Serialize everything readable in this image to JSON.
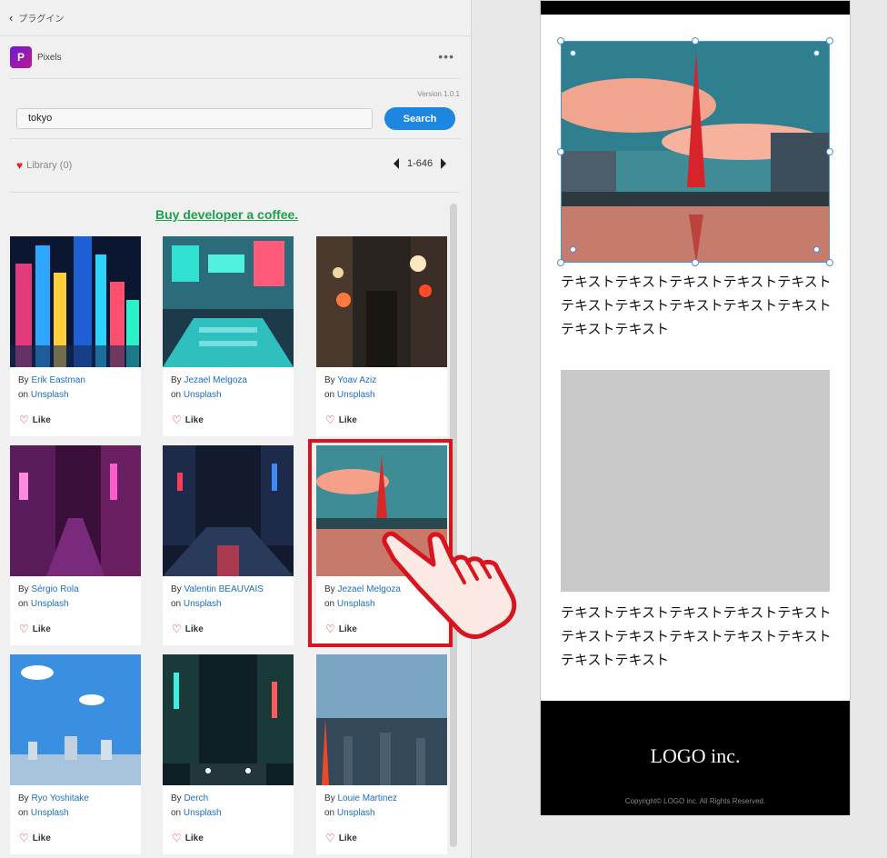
{
  "topbar": {
    "back_label": "プラグイン"
  },
  "plugin": {
    "logo_letter": "P",
    "name": "Pixels",
    "version": "Version 1.0.1"
  },
  "search": {
    "value": "tokyo",
    "button_label": "Search"
  },
  "library": {
    "label": "Library (0)"
  },
  "pager": {
    "range": "1-646"
  },
  "promo": {
    "coffee_label": "Buy developer a coffee."
  },
  "cards": [
    {
      "by": "By",
      "author": "Erik Eastman",
      "on": "on",
      "source": "Unsplash",
      "like": "Like"
    },
    {
      "by": "By",
      "author": "Jezael Melgoza",
      "on": "on",
      "source": "Unsplash",
      "like": "Like"
    },
    {
      "by": "By",
      "author": "Yoav Aziz",
      "on": "on",
      "source": "Unsplash",
      "like": "Like"
    },
    {
      "by": "By",
      "author": "Sérgio Rola",
      "on": "on",
      "source": "Unsplash",
      "like": "Like"
    },
    {
      "by": "By",
      "author": "Valentin BEAUVAIS",
      "on": "on",
      "source": "Unsplash",
      "like": "Like"
    },
    {
      "by": "By",
      "author": "Jezael Melgoza",
      "on": "on",
      "source": "Unsplash",
      "like": "Like"
    },
    {
      "by": "By",
      "author": "Ryo Yoshitake",
      "on": "on",
      "source": "Unsplash",
      "like": "Like"
    },
    {
      "by": "By",
      "author": "Derch",
      "on": "on",
      "source": "Unsplash",
      "like": "Like"
    },
    {
      "by": "By",
      "author": "Louie Martinez",
      "on": "on",
      "source": "Unsplash",
      "like": "Like"
    }
  ],
  "canvas": {
    "text1": "テキストテキストテキストテキストテキストテキストテキストテキストテキストテキストテキストテキスト",
    "text2": "テキストテキストテキストテキストテキストテキストテキストテキストテキストテキストテキストテキスト",
    "logo": "LOGO inc.",
    "copyright": "Copyright© LOGO inc. All Rights Reserved."
  },
  "colors": {
    "accent": "#1c86e0",
    "highlight": "#d8151f",
    "coffee": "#1aa34a"
  }
}
